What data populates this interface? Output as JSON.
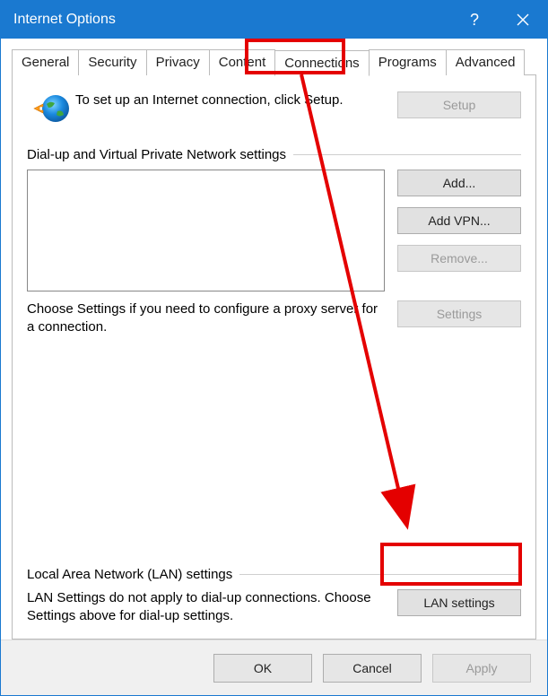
{
  "window": {
    "title": "Internet Options"
  },
  "tabs": {
    "general": "General",
    "security": "Security",
    "privacy": "Privacy",
    "content": "Content",
    "connections": "Connections",
    "programs": "Programs",
    "advanced": "Advanced"
  },
  "setup": {
    "text": "To set up an Internet connection, click Setup.",
    "button": "Setup"
  },
  "dialup": {
    "group_label": "Dial-up and Virtual Private Network settings",
    "add": "Add...",
    "add_vpn": "Add VPN...",
    "remove": "Remove...",
    "settings": "Settings",
    "helper": "Choose Settings if you need to configure a proxy server for a connection."
  },
  "lan": {
    "group_label": "Local Area Network (LAN) settings",
    "helper": "LAN Settings do not apply to dial-up connections. Choose Settings above for dial-up settings.",
    "button": "LAN settings"
  },
  "footer": {
    "ok": "OK",
    "cancel": "Cancel",
    "apply": "Apply"
  }
}
